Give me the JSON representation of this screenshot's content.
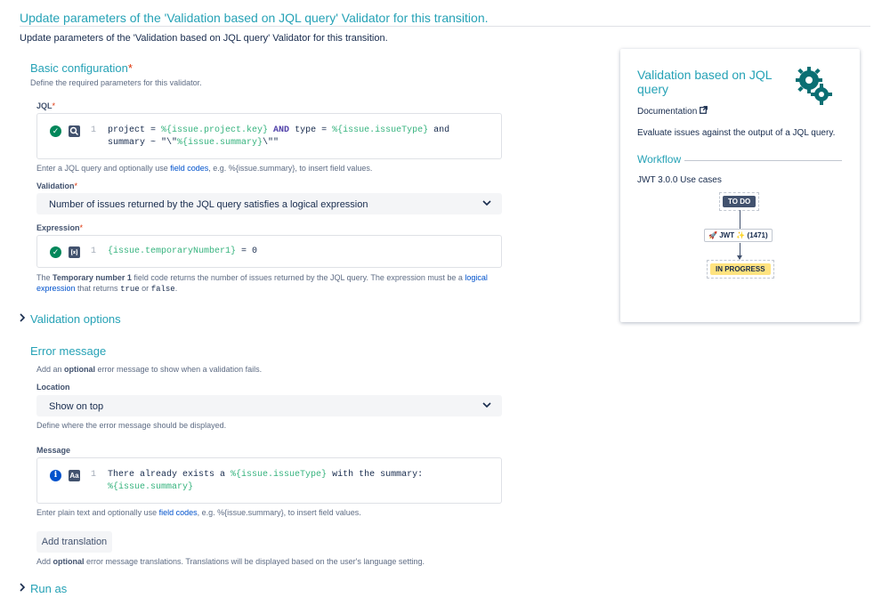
{
  "header": {
    "title": "Update parameters of the 'Validation based on JQL query' Validator for this transition.",
    "subtitle": "Update parameters of the 'Validation based on JQL query' Validator for this transition."
  },
  "basic": {
    "title": "Basic configuration",
    "required_mark": "*",
    "description": "Define the required parameters for this validator.",
    "jql": {
      "label": "JQL",
      "line_number": "1",
      "line1": {
        "t1": "project = ",
        "t2": "%{issue.project.key}",
        "t3": " AND ",
        "t4": "type = ",
        "t5": "%{issue.issueType}",
        "t6": " and"
      },
      "line2": {
        "t1": "summary ~ \"\\\"",
        "t2": "%{issue.summary}",
        "t3": "\\\"\""
      },
      "help_pre": "Enter a JQL query and optionally use ",
      "help_link": "field codes",
      "help_post": ", e.g. %{issue.summary}, to insert field values."
    },
    "validation": {
      "label": "Validation",
      "value": "Number of issues returned by the JQL query satisfies a logical expression"
    },
    "expression": {
      "label": "Expression",
      "line_number": "1",
      "code_fc": "{issue.temporaryNumber1}",
      "code_rest": " = 0",
      "help": {
        "p1": "The ",
        "p2": "Temporary number 1",
        "p3": " field code returns the number of issues returned by the JQL query. The expression must be a ",
        "p4": "logical",
        "p5": "expression",
        "p6": " that returns ",
        "p7": "true",
        "p8": " or ",
        "p9": "false",
        "p10": "."
      }
    }
  },
  "validation_options": {
    "title": "Validation options"
  },
  "error_message": {
    "title": "Error message",
    "desc_pre": "Add an ",
    "desc_bold": "optional",
    "desc_post": " error message to show when a validation fails.",
    "location": {
      "label": "Location",
      "value": "Show on top",
      "help": "Define where the error message should be displayed."
    },
    "message": {
      "label": "Message",
      "line_number": "1",
      "line1": {
        "t1": "There already exists a ",
        "t2": "%{issue.issueType}",
        "t3": " with the summary:"
      },
      "line2": {
        "t1": "%{issue.summary}"
      },
      "help_pre": "Enter plain text and optionally use ",
      "help_link": "field codes",
      "help_post": ", e.g. %{issue.summary}, to insert field values."
    },
    "add_translation": "Add translation",
    "translation_help": {
      "pre": "Add ",
      "bold": "optional",
      "post": " error message translations. Translations will be displayed based on the user's language setting."
    }
  },
  "run_as": {
    "title": "Run as"
  },
  "panel": {
    "title": "Validation based on JQL query",
    "documentation": "Documentation",
    "description": "Evaluate issues against the output of a JQL query.",
    "workflow_title": "Workflow",
    "use_cases": "JWT 3.0.0 Use cases",
    "workflow": {
      "from_status": "TO DO",
      "transition": "JWT",
      "transition_id": "(1471)",
      "to_status": "IN PROGRESS"
    }
  },
  "icons": {
    "valid": "check-circle-icon",
    "jql_tool": "search-icon",
    "expression_tool": "expression-icon",
    "info": "info-icon",
    "text_tool": "text-format-icon",
    "expand": "chevron-right-icon",
    "dropdown": "chevron-down-icon",
    "external": "external-link-icon",
    "gears": "gears-icon",
    "rocket": "rocket-icon",
    "magic": "magic-wand-icon"
  },
  "colors": {
    "accent": "#26a2b6",
    "valid": "#00875a",
    "required": "#de350b",
    "link": "#0052cc",
    "field_code": "#36b37e",
    "keyword": "#5243aa"
  }
}
